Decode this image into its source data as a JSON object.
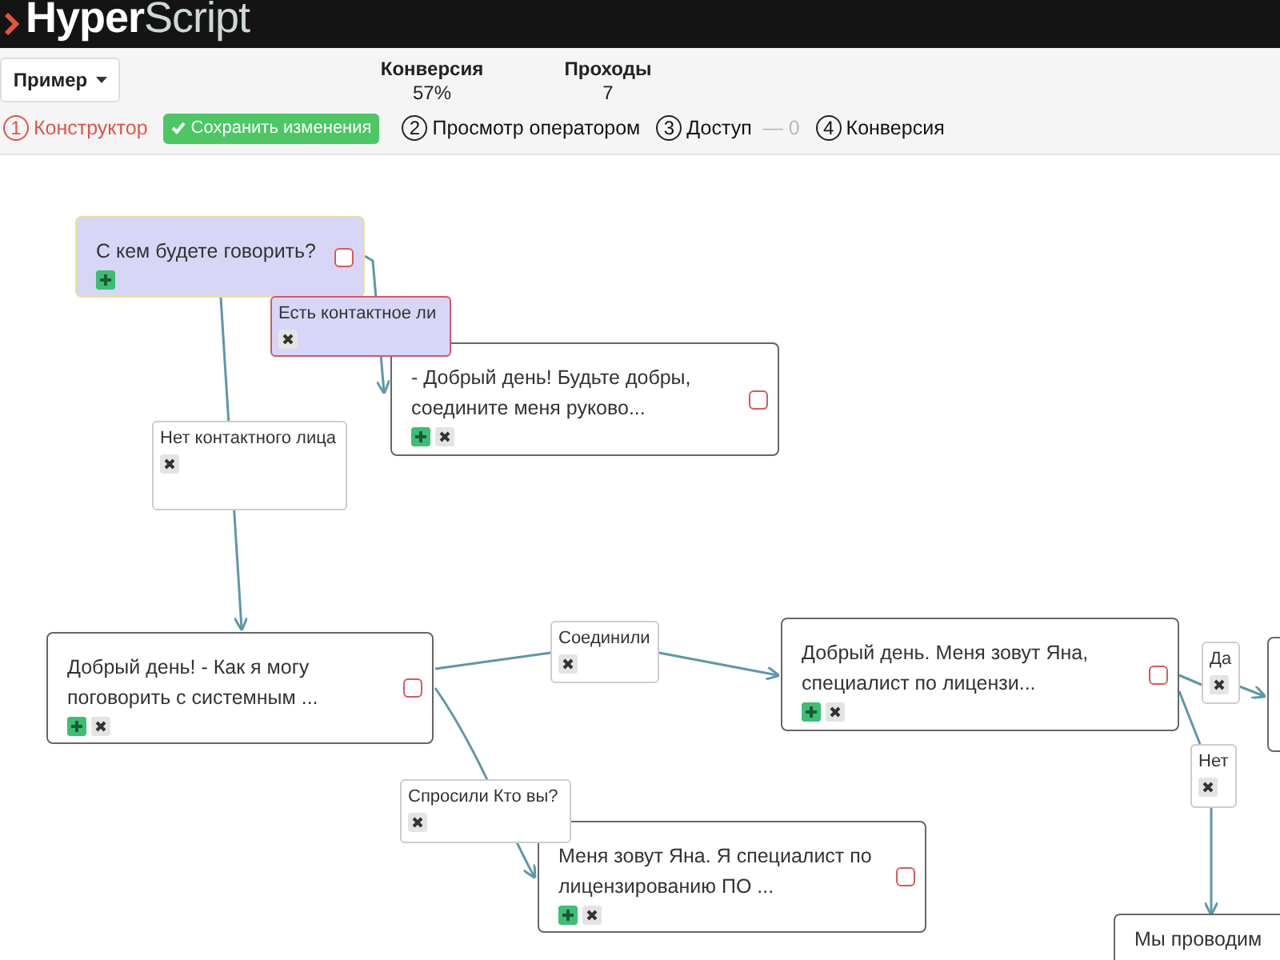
{
  "header": {
    "logo_bold": "Hyper",
    "logo_light": "Script"
  },
  "toolbar": {
    "script_menu": "Пример",
    "stats": [
      {
        "label": "Конверсия",
        "value": "57%"
      },
      {
        "label": "Проходы",
        "value": "7"
      }
    ],
    "steps": [
      {
        "number": "1",
        "label": "Конструктор",
        "selected": true
      },
      {
        "number": "2",
        "label": "Просмотр оператором",
        "selected": false
      },
      {
        "number": "3",
        "label": "Доступ",
        "count": "— 0",
        "selected": false
      },
      {
        "number": "4",
        "label": "Конверсия",
        "selected": false
      }
    ],
    "save_button": "Сохранить изменения"
  },
  "nodes": [
    {
      "kind": "step",
      "text": "С кем будете говорить?",
      "highlighted": true,
      "checked": false,
      "deletable": false
    },
    {
      "kind": "answer",
      "text": "Есть контактное ли",
      "highlighted": true
    },
    {
      "kind": "step",
      "text": "- Добрый день! Будьте добры, соедините меня руково...",
      "highlighted": false,
      "checked": false,
      "deletable": true
    },
    {
      "kind": "answer",
      "text": "Нет контактного лица",
      "highlighted": false
    },
    {
      "kind": "step",
      "text": "Добрый день! - Как я могу поговорить с системным ...",
      "highlighted": false,
      "checked": false,
      "deletable": true
    },
    {
      "kind": "answer",
      "text": "Соединили",
      "highlighted": false
    },
    {
      "kind": "step",
      "text": "Добрый день. Меня зовут Яна, специалист по лицензи...",
      "highlighted": false,
      "checked": false,
      "deletable": true
    },
    {
      "kind": "answer",
      "text": "Да",
      "highlighted": false
    },
    {
      "kind": "edge"
    },
    {
      "kind": "answer",
      "text": "Нет",
      "highlighted": false
    },
    {
      "kind": "answer",
      "text": "Спросили Кто вы?",
      "highlighted": false
    },
    {
      "kind": "step",
      "text": "Меня зовут Яна. Я специалист по лицензированию ПО ...",
      "highlighted": false,
      "checked": false,
      "deletable": true
    },
    {
      "kind": "step",
      "text": "Мы проводим",
      "highlighted": false
    }
  ]
}
